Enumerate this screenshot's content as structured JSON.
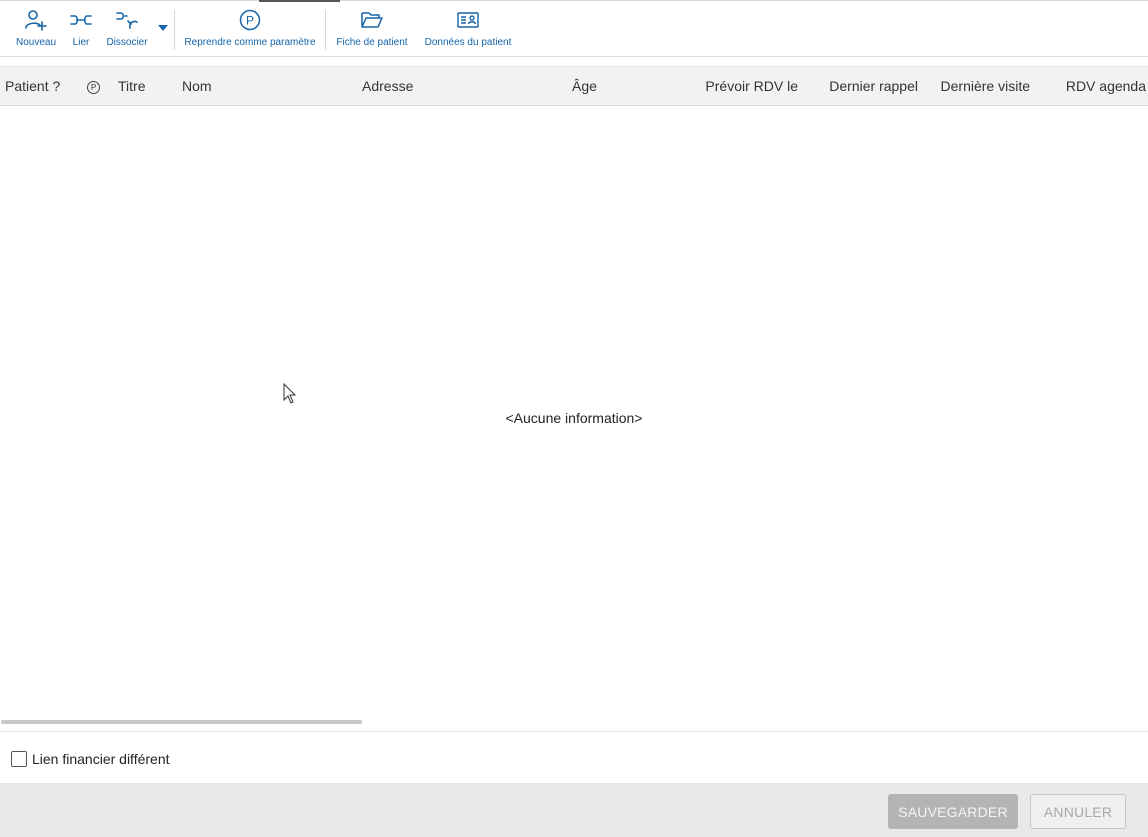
{
  "toolbar": {
    "nouveau": "Nouveau",
    "lier": "Lier",
    "dissocier": "Dissocier",
    "reprendre": "Reprendre comme paramètre",
    "reprendre_icon_letter": "P",
    "fiche": "Fiche de patient",
    "donnees": "Données du patient",
    "icon_color": "#1565a8"
  },
  "grid": {
    "columns": {
      "patient": "Patient ?",
      "p_symbol": "P",
      "titre": "Titre",
      "nom": "Nom",
      "adresse": "Adresse",
      "age": "Âge",
      "prevoir": "Prévoir RDV le",
      "dernier_rappel": "Dernier rappel",
      "derniere_visite": "Dernière visite",
      "rdv_agenda": "RDV agenda"
    },
    "rows": [],
    "empty_message": "<Aucune information>"
  },
  "options": {
    "lien_financier_label": "Lien financier différent",
    "lien_financier_checked": false
  },
  "footer": {
    "save_label": "SAUVEGARDER",
    "cancel_label": "ANNULER"
  }
}
